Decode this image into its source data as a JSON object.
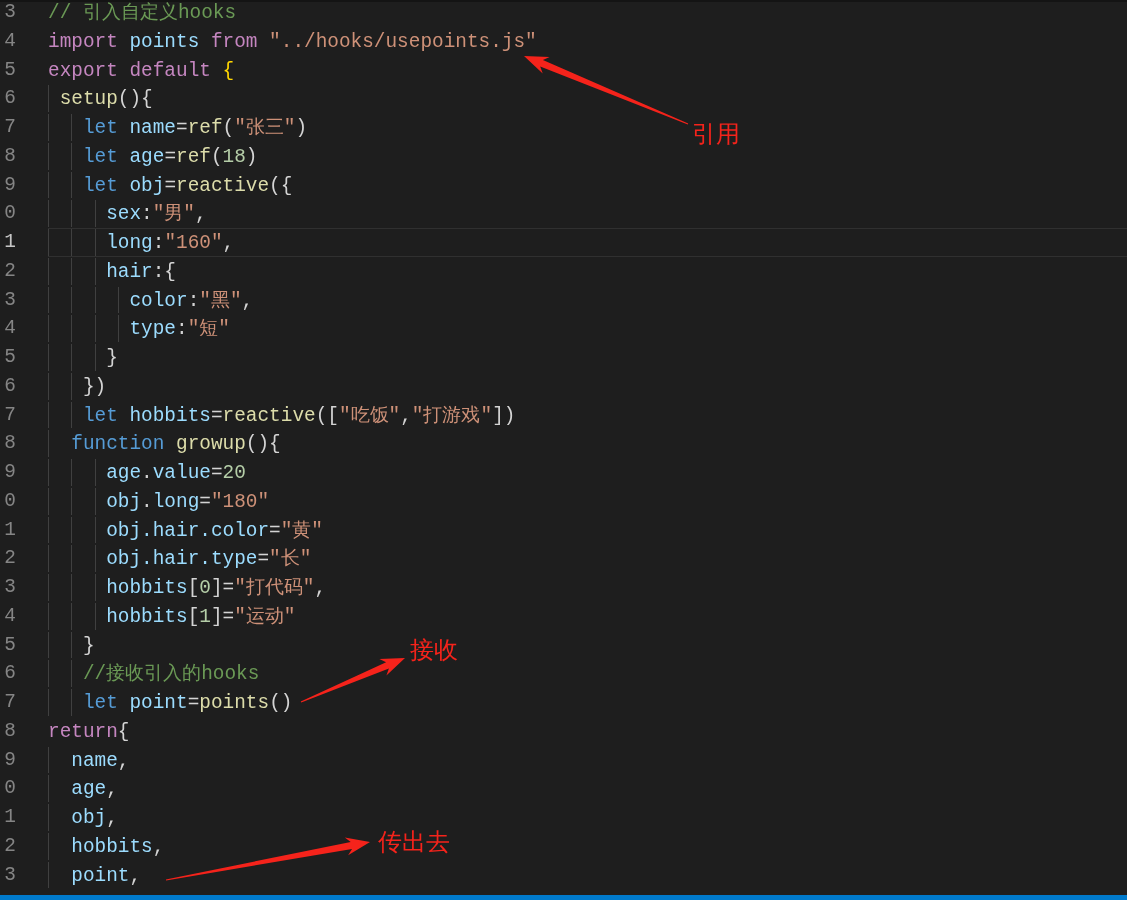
{
  "editor": {
    "lines": [
      {
        "number": "3",
        "current": false,
        "tokens": [
          {
            "kind": "comment",
            "text": "// 引入自定义hooks"
          }
        ]
      },
      {
        "number": "4",
        "current": false,
        "tokens": [
          {
            "kind": "keyword",
            "text": "import"
          },
          {
            "kind": "variable",
            "text": " points"
          },
          {
            "kind": "keyword",
            "text": " from"
          },
          {
            "kind": "string",
            "text": " \"../hooks/usepoints.js\""
          }
        ]
      },
      {
        "number": "5",
        "current": false,
        "tokens": [
          {
            "kind": "keyword",
            "text": "export"
          },
          {
            "kind": "keyword",
            "text": " default"
          },
          {
            "kind": "bracket",
            "text": " {"
          }
        ]
      },
      {
        "number": "6",
        "current": false,
        "tokens": [
          {
            "kind": "function",
            "text": " setup"
          },
          {
            "kind": "punct",
            "text": "(){"
          }
        ]
      },
      {
        "number": "7",
        "current": false,
        "tokens": [
          {
            "kind": "storage",
            "text": "   let"
          },
          {
            "kind": "variable",
            "text": " name"
          },
          {
            "kind": "punct",
            "text": "="
          },
          {
            "kind": "function",
            "text": "ref"
          },
          {
            "kind": "punct",
            "text": "("
          },
          {
            "kind": "string",
            "text": "\"张三\""
          },
          {
            "kind": "punct",
            "text": ")"
          }
        ]
      },
      {
        "number": "8",
        "current": false,
        "tokens": [
          {
            "kind": "storage",
            "text": "   let"
          },
          {
            "kind": "variable",
            "text": " age"
          },
          {
            "kind": "punct",
            "text": "="
          },
          {
            "kind": "function",
            "text": "ref"
          },
          {
            "kind": "punct",
            "text": "("
          },
          {
            "kind": "number",
            "text": "18"
          },
          {
            "kind": "punct",
            "text": ")"
          }
        ]
      },
      {
        "number": "9",
        "current": false,
        "tokens": [
          {
            "kind": "storage",
            "text": "   let"
          },
          {
            "kind": "variable",
            "text": " obj"
          },
          {
            "kind": "punct",
            "text": "="
          },
          {
            "kind": "function",
            "text": "reactive"
          },
          {
            "kind": "punct",
            "text": "({"
          }
        ]
      },
      {
        "number": "0",
        "current": false,
        "tokens": [
          {
            "kind": "variable",
            "text": "     sex"
          },
          {
            "kind": "punct",
            "text": ":"
          },
          {
            "kind": "string",
            "text": "\"男\""
          },
          {
            "kind": "punct",
            "text": ","
          }
        ]
      },
      {
        "number": "1",
        "current": true,
        "tokens": [
          {
            "kind": "variable",
            "text": "     long"
          },
          {
            "kind": "punct",
            "text": ":"
          },
          {
            "kind": "string",
            "text": "\"160\""
          },
          {
            "kind": "punct",
            "text": ","
          }
        ]
      },
      {
        "number": "2",
        "current": false,
        "tokens": [
          {
            "kind": "variable",
            "text": "     hair"
          },
          {
            "kind": "punct",
            "text": ":{"
          }
        ]
      },
      {
        "number": "3",
        "current": false,
        "tokens": [
          {
            "kind": "variable",
            "text": "       color"
          },
          {
            "kind": "punct",
            "text": ":"
          },
          {
            "kind": "string",
            "text": "\"黑\""
          },
          {
            "kind": "punct",
            "text": ","
          }
        ]
      },
      {
        "number": "4",
        "current": false,
        "tokens": [
          {
            "kind": "variable",
            "text": "       type"
          },
          {
            "kind": "punct",
            "text": ":"
          },
          {
            "kind": "string",
            "text": "\"短\""
          }
        ]
      },
      {
        "number": "5",
        "current": false,
        "tokens": [
          {
            "kind": "punct",
            "text": "     }"
          }
        ]
      },
      {
        "number": "6",
        "current": false,
        "tokens": [
          {
            "kind": "punct",
            "text": "   })"
          }
        ]
      },
      {
        "number": "7",
        "current": false,
        "tokens": [
          {
            "kind": "storage",
            "text": "   let"
          },
          {
            "kind": "variable",
            "text": " hobbits"
          },
          {
            "kind": "punct",
            "text": "="
          },
          {
            "kind": "function",
            "text": "reactive"
          },
          {
            "kind": "punct",
            "text": "(["
          },
          {
            "kind": "string",
            "text": "\"吃饭\""
          },
          {
            "kind": "punct",
            "text": ","
          },
          {
            "kind": "string",
            "text": "\"打游戏\""
          },
          {
            "kind": "punct",
            "text": "])"
          }
        ]
      },
      {
        "number": "8",
        "current": false,
        "tokens": [
          {
            "kind": "storage",
            "text": "  function"
          },
          {
            "kind": "function",
            "text": " growup"
          },
          {
            "kind": "punct",
            "text": "(){"
          }
        ]
      },
      {
        "number": "9",
        "current": false,
        "tokens": [
          {
            "kind": "variable",
            "text": "     age"
          },
          {
            "kind": "punct",
            "text": "."
          },
          {
            "kind": "variable",
            "text": "value"
          },
          {
            "kind": "punct",
            "text": "="
          },
          {
            "kind": "number",
            "text": "20"
          }
        ]
      },
      {
        "number": "0",
        "current": false,
        "tokens": [
          {
            "kind": "variable",
            "text": "     obj"
          },
          {
            "kind": "punct",
            "text": "."
          },
          {
            "kind": "variable",
            "text": "long"
          },
          {
            "kind": "punct",
            "text": "="
          },
          {
            "kind": "string",
            "text": "\"180\""
          }
        ]
      },
      {
        "number": "1",
        "current": false,
        "tokens": [
          {
            "kind": "variable",
            "text": "     obj.hair.color"
          },
          {
            "kind": "punct",
            "text": "="
          },
          {
            "kind": "string",
            "text": "\"黄\""
          }
        ]
      },
      {
        "number": "2",
        "current": false,
        "tokens": [
          {
            "kind": "variable",
            "text": "     obj.hair.type"
          },
          {
            "kind": "punct",
            "text": "="
          },
          {
            "kind": "string",
            "text": "\"长\""
          }
        ]
      },
      {
        "number": "3",
        "current": false,
        "tokens": [
          {
            "kind": "variable",
            "text": "     hobbits"
          },
          {
            "kind": "punct",
            "text": "["
          },
          {
            "kind": "number",
            "text": "0"
          },
          {
            "kind": "punct",
            "text": "]="
          },
          {
            "kind": "string",
            "text": "\"打代码\""
          },
          {
            "kind": "punct",
            "text": ","
          }
        ]
      },
      {
        "number": "4",
        "current": false,
        "tokens": [
          {
            "kind": "variable",
            "text": "     hobbits"
          },
          {
            "kind": "punct",
            "text": "["
          },
          {
            "kind": "number",
            "text": "1"
          },
          {
            "kind": "punct",
            "text": "]="
          },
          {
            "kind": "string",
            "text": "\"运动\""
          }
        ]
      },
      {
        "number": "5",
        "current": false,
        "tokens": [
          {
            "kind": "punct",
            "text": "   }"
          }
        ]
      },
      {
        "number": "6",
        "current": false,
        "tokens": [
          {
            "kind": "comment",
            "text": "   //接收引入的hooks"
          }
        ]
      },
      {
        "number": "7",
        "current": false,
        "tokens": [
          {
            "kind": "storage",
            "text": "   let"
          },
          {
            "kind": "variable",
            "text": " point"
          },
          {
            "kind": "punct",
            "text": "="
          },
          {
            "kind": "function",
            "text": "points"
          },
          {
            "kind": "punct",
            "text": "()"
          }
        ]
      },
      {
        "number": "8",
        "current": false,
        "tokens": [
          {
            "kind": "keyword",
            "text": "return"
          },
          {
            "kind": "punct",
            "text": "{"
          }
        ]
      },
      {
        "number": "9",
        "current": false,
        "tokens": [
          {
            "kind": "variable",
            "text": "  name"
          },
          {
            "kind": "punct",
            "text": ","
          }
        ]
      },
      {
        "number": "0",
        "current": false,
        "tokens": [
          {
            "kind": "variable",
            "text": "  age"
          },
          {
            "kind": "punct",
            "text": ","
          }
        ]
      },
      {
        "number": "1",
        "current": false,
        "tokens": [
          {
            "kind": "variable",
            "text": "  obj"
          },
          {
            "kind": "punct",
            "text": ","
          }
        ]
      },
      {
        "number": "2",
        "current": false,
        "tokens": [
          {
            "kind": "variable",
            "text": "  hobbits"
          },
          {
            "kind": "punct",
            "text": ","
          }
        ]
      },
      {
        "number": "3",
        "current": false,
        "tokens": [
          {
            "kind": "variable",
            "text": "  point"
          },
          {
            "kind": "punct",
            "text": ","
          }
        ]
      }
    ]
  },
  "annotations": [
    {
      "text": "引用"
    },
    {
      "text": "接收"
    },
    {
      "text": "传出去"
    }
  ]
}
